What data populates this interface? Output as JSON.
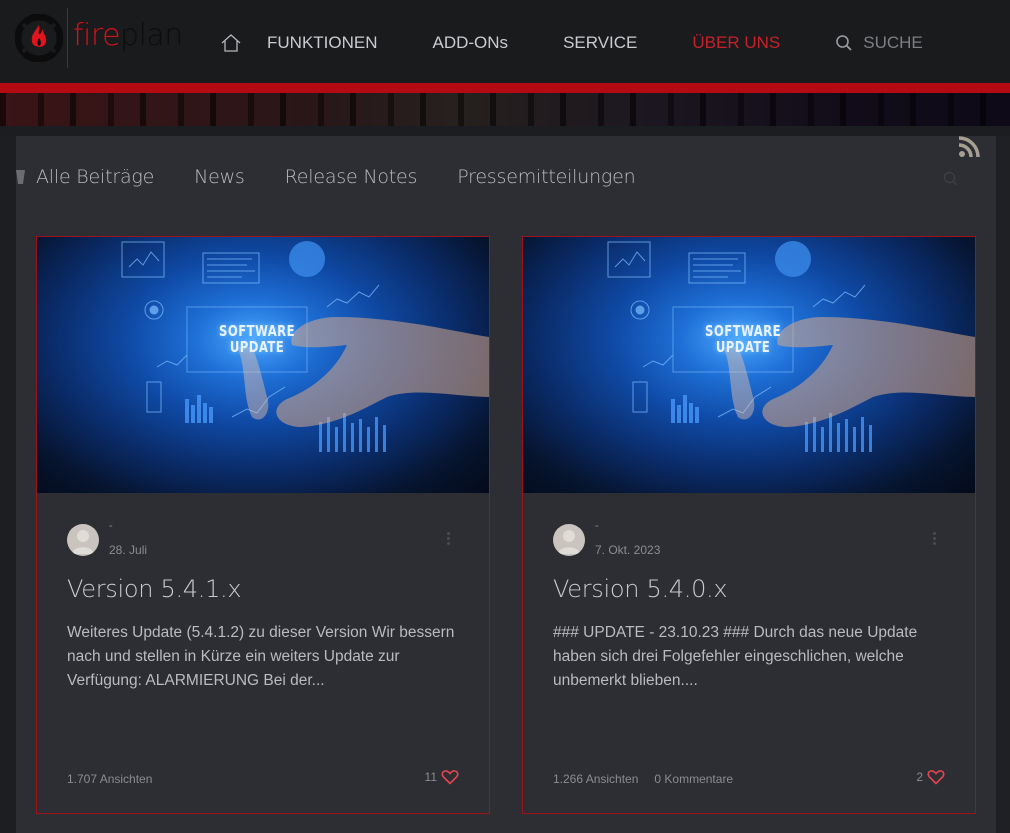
{
  "header": {
    "logo": {
      "part1": "fire",
      "part2": "plan"
    },
    "nav": {
      "home_icon": "home-icon",
      "items": [
        {
          "label": "FUNKTIONEN",
          "active": false
        },
        {
          "label": "ADD-ONs",
          "active": false
        },
        {
          "label": "SERVICE",
          "active": false
        },
        {
          "label": "ÜBER UNS",
          "active": true
        }
      ],
      "search_label": "SUCHE"
    }
  },
  "blog": {
    "categories": [
      "Alle Beiträge",
      "News",
      "Release Notes",
      "Pressemitteilungen"
    ],
    "rss_icon": "rss-icon",
    "search_icon": "search-icon",
    "posts": [
      {
        "image_caption": "SOFTWARE UPDATE",
        "author": "-",
        "date": "28. Juli",
        "title": "Version 5.4.1.x",
        "excerpt": "Weiteres Update (5.4.1.2) zu dieser Version Wir bessern nach und stellen in Kürze ein weiters Update zur Verfügung: ALARMIERUNG Bei der...",
        "views": "1.707 Ansichten",
        "comments": "",
        "likes": "11"
      },
      {
        "image_caption": "SOFTWARE UPDATE",
        "author": "-",
        "date": "7. Okt. 2023",
        "title": "Version 5.4.0.x",
        "excerpt": "### UPDATE - 23.10.23 ### Durch das neue Update haben sich drei Folgefehler eingeschlichen, welche unbemerkt blieben....",
        "views": "1.266 Ansichten",
        "comments": "0 Kommentare",
        "likes": "2"
      }
    ]
  },
  "colors": {
    "accent_red": "#b30a13",
    "active_nav": "#c8202a",
    "heart": "#e0464e",
    "panel_bg": "#2c2e33"
  }
}
